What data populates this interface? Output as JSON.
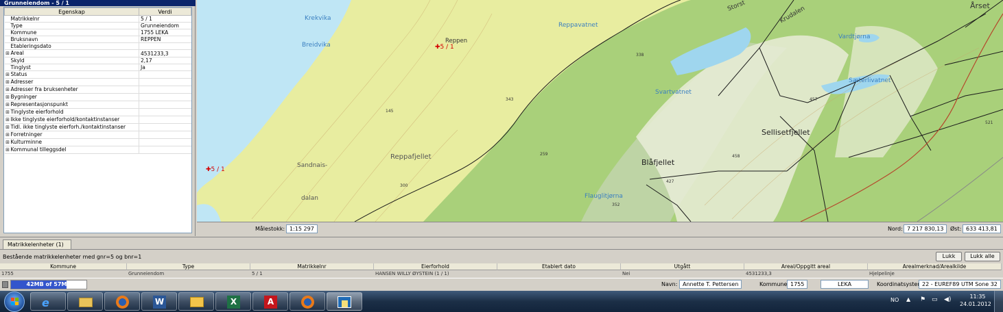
{
  "properties_panel": {
    "title": "Grunneiendom - 5 / 1",
    "col_property": "Egenskap",
    "col_value": "Verdi",
    "rows": [
      {
        "expand": "",
        "label": "Matrikkelnr",
        "value": "5 / 1"
      },
      {
        "expand": "",
        "label": "Type",
        "value": "Grunneiendom"
      },
      {
        "expand": "",
        "label": "Kommune",
        "value": "1755  LEKA"
      },
      {
        "expand": "",
        "label": "Bruksnavn",
        "value": "REPPEN"
      },
      {
        "expand": "",
        "label": "Etableringsdato",
        "value": ""
      },
      {
        "expand": "⊞",
        "label": "Areal",
        "value": "4531233,3"
      },
      {
        "expand": "",
        "label": "Skyld",
        "value": "2,17"
      },
      {
        "expand": "",
        "label": "Tinglyst",
        "value": "Ja"
      },
      {
        "expand": "⊞",
        "label": "Status",
        "value": ""
      },
      {
        "expand": "⊞",
        "label": "Adresser",
        "value": ""
      },
      {
        "expand": "⊞",
        "label": "Adresser fra bruksenheter",
        "value": ""
      },
      {
        "expand": "⊞",
        "label": "Bygninger",
        "value": ""
      },
      {
        "expand": "⊞",
        "label": "Representasjonspunkt",
        "value": ""
      },
      {
        "expand": "⊞",
        "label": "Tinglyste eierforhold",
        "value": ""
      },
      {
        "expand": "⊞",
        "label": "Ikke tinglyste eierforhold/kontaktinstanser",
        "value": ""
      },
      {
        "expand": "⊞",
        "label": "Tidl. ikke tinglyste eierforh./kontaktinstanser",
        "value": ""
      },
      {
        "expand": "⊞",
        "label": "Forretninger",
        "value": ""
      },
      {
        "expand": "⊞",
        "label": "Kulturminne",
        "value": ""
      },
      {
        "expand": "⊞",
        "label": "Kommunal tilleggsdel",
        "value": ""
      }
    ]
  },
  "map": {
    "labels": {
      "krekvika": "Krekvika",
      "breidvika": "Breidvika",
      "reppen": "Reppen",
      "reppen_parcel": "5 / 1",
      "west_parcel": "5 / 1",
      "reppavatnet": "Reppavatnet",
      "storst": "Storst",
      "krudalen": "Krudalen",
      "vardtjorna": "Vardtjørna",
      "arset": "Årset",
      "saterlivatnet": "Sæterlivatnet",
      "svartvatnet": "Svartvatnet",
      "sellisetfjellet": "Sellisetfjellet",
      "blafjellet": "Blåfjellet",
      "reppafjellet": "Reppafjellet",
      "sandnais": "Sandnais-",
      "dalan": "dalan",
      "flauglitjorna": "Flauglitjørna",
      "h338": "338",
      "h343": "343",
      "h145": "145",
      "h300": "300",
      "h259": "259",
      "h457": "457",
      "h458": "458",
      "h427": "427",
      "h352": "352",
      "h521": "521"
    },
    "scale_label": "Målestokk:",
    "scale_value": "1:15 297",
    "north_label": "Nord:",
    "north_value": "7 217 830,13",
    "east_label": "Øst:",
    "east_value": "633 413,81"
  },
  "bottom_panel": {
    "tab_label": "Matrikkelenheter (1)",
    "query_text": "Bestående matrikkelenheter med gnr=5 og  bnr=1",
    "close_label": "Lukk",
    "close_all_label": "Lukk alle",
    "columns": [
      "Kommune",
      "Type",
      "Matrikkelnr",
      "Eierforhold",
      "Etablert dato",
      "Utgått",
      "Areal/Oppgitt areal",
      "Arealmerknad/Arealkilde"
    ],
    "row": [
      "1755",
      "Grunneiendom",
      "5 / 1",
      "HANSEN WILLY ØYSTEIN (1 / 1)",
      "",
      "Nei",
      "4531233,3",
      "Hjelpelinje"
    ]
  },
  "status_bar": {
    "memory": "42MB of 57MB",
    "memory_fraction": 0.74,
    "name_label": "Navn:",
    "name_value": "Annette T. Pettersen",
    "kommune_label": "Kommune:",
    "kommune_number": "1755",
    "kommune_name": "LEKA",
    "coord_label": "Koordinatsystem:",
    "coord_value": "22 - EUREF89 UTM Sone 32"
  },
  "taskbar": {
    "lang": "NO",
    "time": "11:35",
    "date": "24.01.2012"
  },
  "colors": {
    "land": "#e8eda0",
    "forest": "#b9d98a",
    "water": "#bfe6f5",
    "boundary": "#1a1a1a",
    "water_label": "#3a7fc0",
    "parcel_red": "#d40000"
  }
}
